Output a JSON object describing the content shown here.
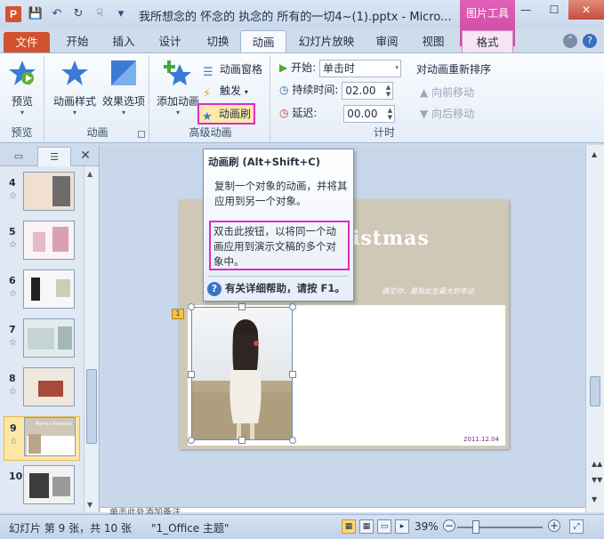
{
  "window": {
    "title": "我所想念的 怀念的 执念的 所有的一切4~(1).pptx - Micro...",
    "context_tool_group": "图片工具"
  },
  "tabs": [
    {
      "label": "文件"
    },
    {
      "label": "开始"
    },
    {
      "label": "插入"
    },
    {
      "label": "设计"
    },
    {
      "label": "切换"
    },
    {
      "label": "动画"
    },
    {
      "label": "幻灯片放映"
    },
    {
      "label": "审阅"
    },
    {
      "label": "视图"
    },
    {
      "label": "格式"
    }
  ],
  "ribbon": {
    "preview": {
      "button": "预览",
      "group": "预览"
    },
    "animation": {
      "style_button": "动画样式",
      "effect_button": "效果选项",
      "group": "动画"
    },
    "advanced": {
      "add_button": "添加动画",
      "pane_button": "动画窗格",
      "trigger_button": "触发",
      "painter_button": "动画刷",
      "group": "高级动画"
    },
    "timing": {
      "start_label": "开始:",
      "start_value": "单击时",
      "duration_label": "持续时间:",
      "duration_value": "02.00",
      "delay_label": "延迟:",
      "delay_value": "00.00",
      "reorder_title": "对动画重新排序",
      "move_earlier": "向前移动",
      "move_later": "向后移动",
      "group": "计时"
    }
  },
  "tooltip": {
    "title": "动画刷 (Alt+Shift+C)",
    "description": "复制一个对象的动画，并将其应用到另一个对象。",
    "tip": "双击此按钮，以将同一个动画应用到演示文稿的多个对象中。",
    "help": "有关详细帮助，请按 F1。"
  },
  "slides_panel": {
    "thumbnails": [
      {
        "number": "4",
        "star": "☆"
      },
      {
        "number": "5",
        "star": "☆"
      },
      {
        "number": "6",
        "star": "☆"
      },
      {
        "number": "7",
        "star": "☆"
      },
      {
        "number": "8",
        "star": "☆"
      },
      {
        "number": "9",
        "star": "☆",
        "selected": true
      },
      {
        "number": "10",
        "star": ""
      }
    ]
  },
  "slide": {
    "title_fragment": "istmas",
    "subtitle": "遇见你，是我此生最大的幸运",
    "date": "2011.12.04",
    "animation_badge": "1",
    "thumb_title": "Merry Christmas"
  },
  "notes_text": "单击此处添加备注",
  "status": {
    "slide_info": "幻灯片 第 9 张，共 10 张",
    "theme": "\"1_Office 主题\"",
    "zoom": "39%",
    "zoom_level_percent": 39
  },
  "colors": {
    "file_tab": "#d3512d",
    "highlight_border": "#e02ac0",
    "context_tab": "#c94aa0"
  }
}
